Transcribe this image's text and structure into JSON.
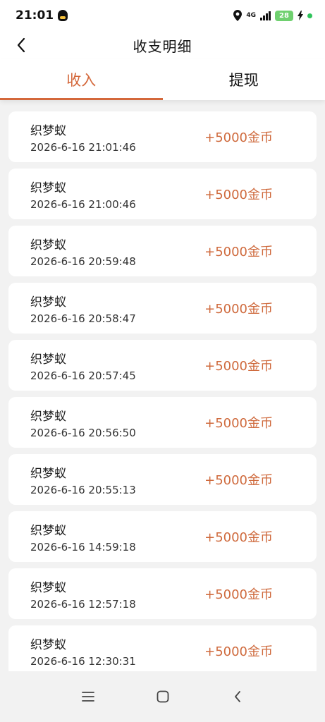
{
  "status": {
    "time": "21:01",
    "network": "4G",
    "battery": "28"
  },
  "header": {
    "title": "收支明细"
  },
  "tabs": [
    {
      "label": "收入"
    },
    {
      "label": "提现"
    }
  ],
  "records": [
    {
      "title": "织梦蚁",
      "time": "2026-6-16 21:01:46",
      "amount": "+5000金币"
    },
    {
      "title": "织梦蚁",
      "time": "2026-6-16 21:00:46",
      "amount": "+5000金币"
    },
    {
      "title": "织梦蚁",
      "time": "2026-6-16 20:59:48",
      "amount": "+5000金币"
    },
    {
      "title": "织梦蚁",
      "time": "2026-6-16 20:58:47",
      "amount": "+5000金币"
    },
    {
      "title": "织梦蚁",
      "time": "2026-6-16 20:57:45",
      "amount": "+5000金币"
    },
    {
      "title": "织梦蚁",
      "time": "2026-6-16 20:56:50",
      "amount": "+5000金币"
    },
    {
      "title": "织梦蚁",
      "time": "2026-6-16 20:55:13",
      "amount": "+5000金币"
    },
    {
      "title": "织梦蚁",
      "time": "2026-6-16 14:59:18",
      "amount": "+5000金币"
    },
    {
      "title": "织梦蚁",
      "time": "2026-6-16 12:57:18",
      "amount": "+5000金币"
    },
    {
      "title": "织梦蚁",
      "time": "2026-6-16 12:30:31",
      "amount": "+5000金币"
    }
  ],
  "colors": {
    "accent": "#d4683b",
    "amount": "#cf6a3d",
    "background": "#f2f2f2"
  },
  "icons": {
    "back": "chevron-left-icon",
    "menu": "menu-icon",
    "home": "home-icon",
    "nav_back": "back-icon"
  }
}
